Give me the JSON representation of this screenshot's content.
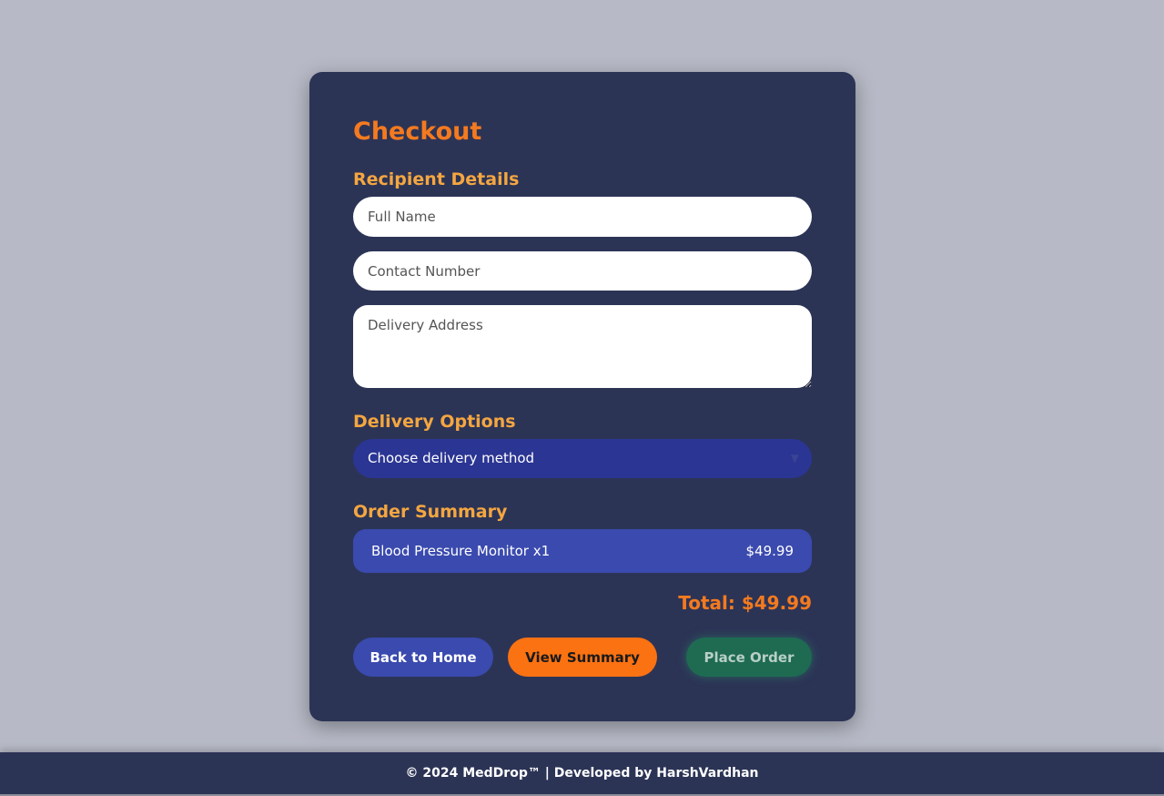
{
  "checkout": {
    "title": "Checkout",
    "recipient": {
      "label": "Recipient Details",
      "full_name_placeholder": "Full Name",
      "contact_placeholder": "Contact Number",
      "address_placeholder": "Delivery Address"
    },
    "delivery": {
      "label": "Delivery Options",
      "selected": "Choose delivery method",
      "chevron_icon": "chevron-down-icon"
    },
    "summary": {
      "label": "Order Summary",
      "items": [
        {
          "name": "Blood Pressure Monitor x1",
          "price": "$49.99"
        }
      ],
      "total": "Total: $49.99"
    },
    "buttons": {
      "back": "Back to Home",
      "view_summary": "View Summary",
      "place_order": "Place Order"
    }
  },
  "footer": {
    "text": "© 2024 MedDrop™ | Developed by HarshVardhan"
  },
  "colors": {
    "background": "#b7bac6",
    "card": "#2c3456",
    "title": "#f47a1f",
    "section_label": "#f4a640",
    "select_bg": "#2b3593",
    "summary_bg": "#3a4aae",
    "button_home": "#3a4aae",
    "button_summary": "#fb7212",
    "button_place": "#1e6b52"
  }
}
